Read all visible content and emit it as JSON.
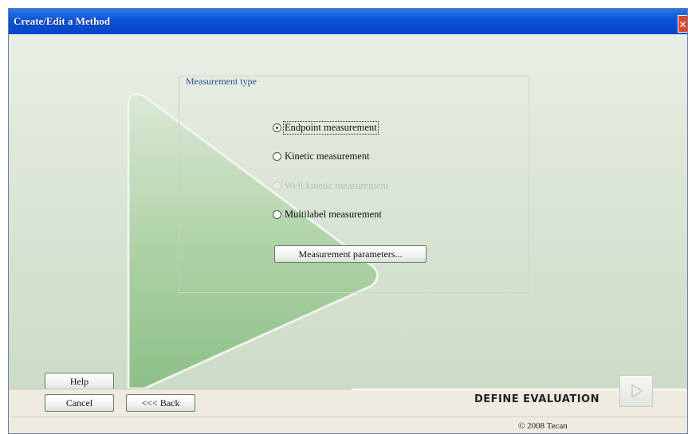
{
  "window": {
    "title": "Create/Edit a Method",
    "close_glyph": "✕"
  },
  "group": {
    "label": "Measurement type"
  },
  "options": [
    {
      "label": "Endpoint measurement",
      "selected": true,
      "enabled": true
    },
    {
      "label": "Kinetic measurement",
      "selected": false,
      "enabled": true
    },
    {
      "label": "Well kinetic measurement",
      "selected": false,
      "enabled": false
    },
    {
      "label": "Multilabel measurement",
      "selected": false,
      "enabled": true
    }
  ],
  "buttons": {
    "parameters": "Measurement parameters...",
    "help": "Help",
    "cancel": "Cancel",
    "back": "<<< Back"
  },
  "footer": {
    "step_label": "DEFINE EVALUATION",
    "next_icon": "play-arrow-icon",
    "copyright": "© 2008 Tecan"
  },
  "colors": {
    "titlebar": "#0a52d8",
    "group_label": "#2c4f9a",
    "arrow": "#9fc89a"
  }
}
